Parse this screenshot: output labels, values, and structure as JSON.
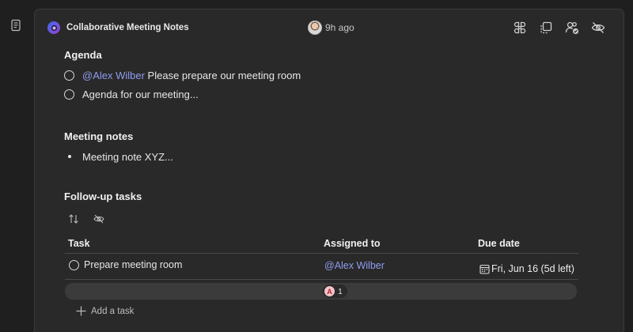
{
  "header": {
    "title": "Collaborative Meeting Notes",
    "time_ago": "9h ago",
    "actions": [
      {
        "name": "apps-icon"
      },
      {
        "name": "copy-component-icon"
      },
      {
        "name": "share-people-icon"
      },
      {
        "name": "hide-icon"
      }
    ]
  },
  "agenda": {
    "heading": "Agenda",
    "items": [
      {
        "mention": "@Alex Wilber",
        "text": " Please prepare our meeting room"
      },
      {
        "mention": "",
        "text": "Agenda for our meeting..."
      }
    ]
  },
  "meeting_notes": {
    "heading": "Meeting notes",
    "bullets": [
      "Meeting note XYZ..."
    ]
  },
  "followup": {
    "heading": "Follow-up tasks",
    "columns": {
      "task": "Task",
      "assigned": "Assigned to",
      "due": "Due date"
    },
    "rows": [
      {
        "task": "Prepare meeting room",
        "assigned": "@Alex Wilber",
        "due": "Fri, Jun 16 (5d left)"
      }
    ],
    "summary": {
      "avatar_initial": "A",
      "count": "1"
    },
    "add_task_label": "Add a task"
  },
  "colors": {
    "mention": "#8f9df0",
    "background": "#292929",
    "loop_brand": "#7b4fd6"
  }
}
